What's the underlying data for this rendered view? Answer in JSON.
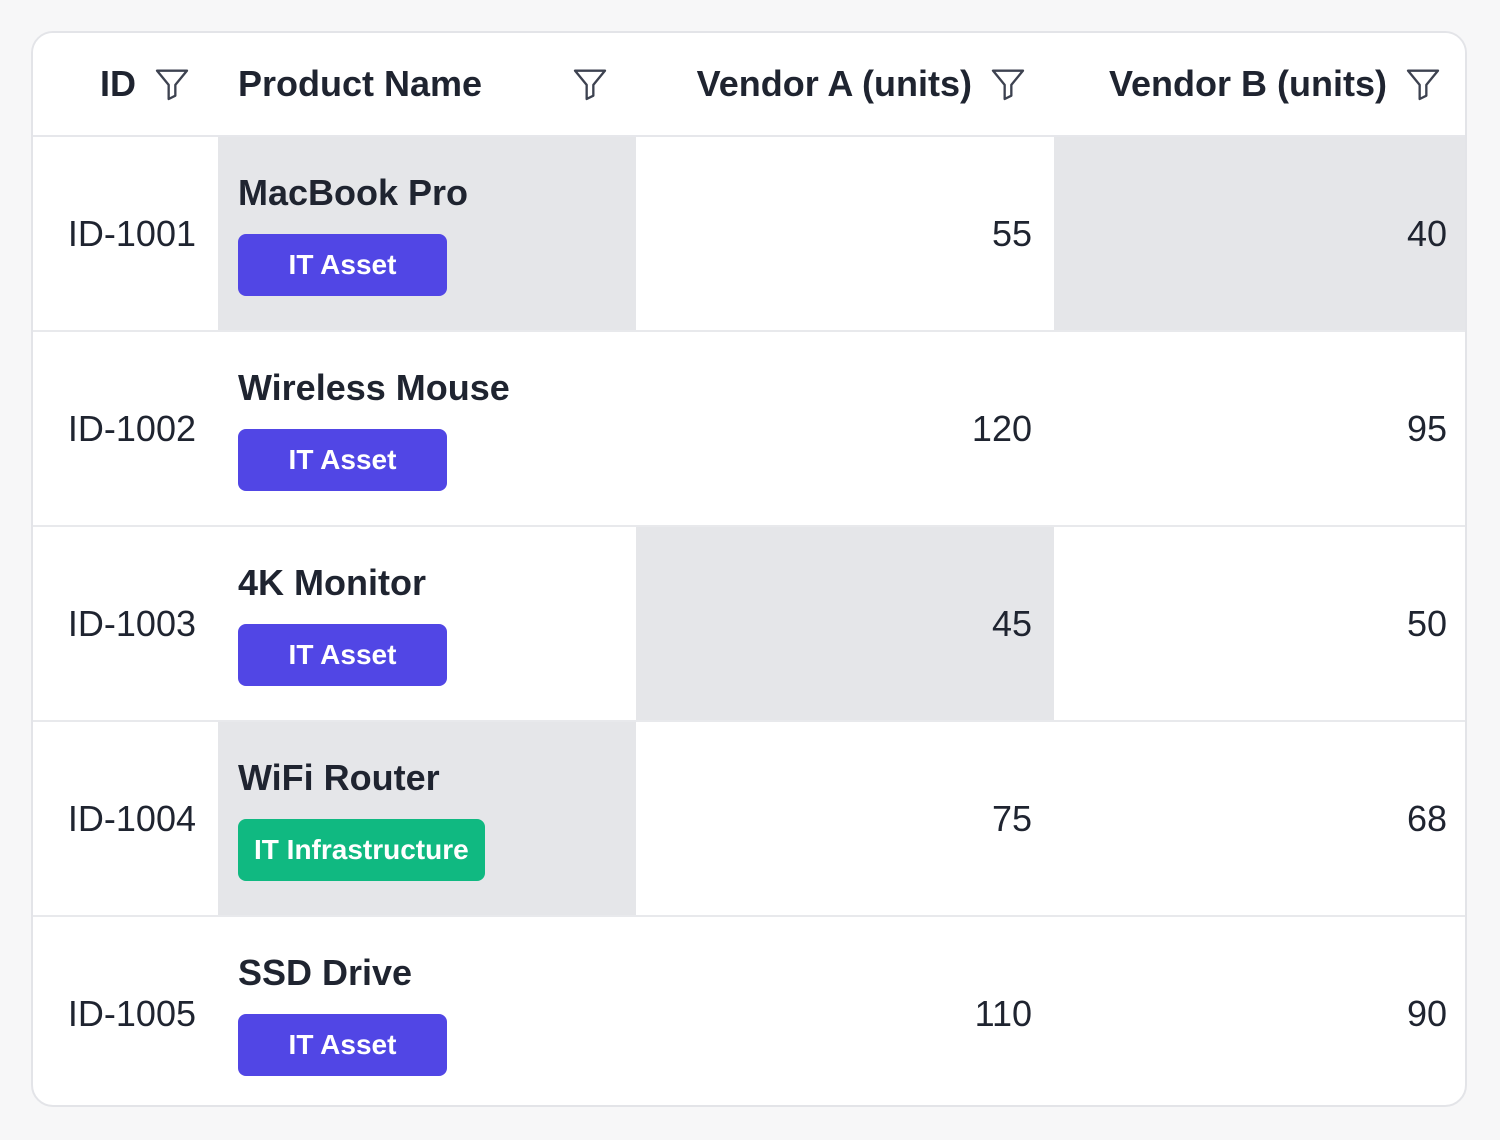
{
  "table": {
    "columns": [
      {
        "label": "ID",
        "icon": "filter-icon"
      },
      {
        "label": "Product Name",
        "icon": "filter-icon"
      },
      {
        "label": "Vendor A (units)",
        "icon": "filter-icon"
      },
      {
        "label": "Vendor B (units)",
        "icon": "filter-icon"
      }
    ],
    "rows": [
      {
        "id": "ID-1001",
        "name": "MacBook Pro",
        "tag": "IT Asset",
        "vendor_a": "55",
        "vendor_b": "40"
      },
      {
        "id": "ID-1002",
        "name": "Wireless Mouse",
        "tag": "IT Asset",
        "vendor_a": "120",
        "vendor_b": "95"
      },
      {
        "id": "ID-1003",
        "name": "4K Monitor",
        "tag": "IT Asset",
        "vendor_a": "45",
        "vendor_b": "50"
      },
      {
        "id": "ID-1004",
        "name": "WiFi Router",
        "tag": "IT Infrastructure",
        "vendor_a": "75",
        "vendor_b": "68"
      },
      {
        "id": "ID-1005",
        "name": "SSD Drive",
        "tag": "IT Asset",
        "vendor_a": "110",
        "vendor_b": "90"
      }
    ]
  },
  "colors": {
    "asset_tag": "#5146e5",
    "infra_tag": "#10b981",
    "highlight_cell": "#e5e6e9",
    "text": "#1f2430"
  }
}
